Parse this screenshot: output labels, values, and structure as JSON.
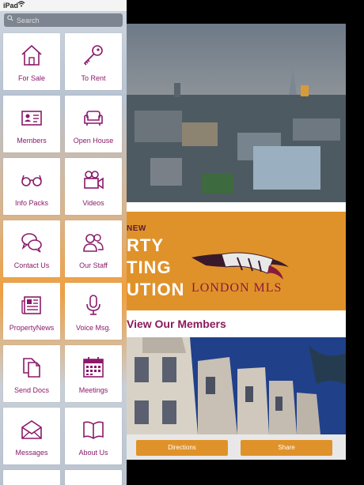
{
  "status": {
    "device": "iPad",
    "wifi_icon": "wifi-icon"
  },
  "search": {
    "placeholder": "Search",
    "icon": "search-icon"
  },
  "menu": [
    {
      "label": "For Sale",
      "icon": "house-icon"
    },
    {
      "label": "To Rent",
      "icon": "key-icon"
    },
    {
      "label": "Members",
      "icon": "id-card-icon"
    },
    {
      "label": "Open House",
      "icon": "sofa-icon"
    },
    {
      "label": "Info Packs",
      "icon": "glasses-icon"
    },
    {
      "label": "Videos",
      "icon": "video-camera-icon"
    },
    {
      "label": "Contact Us",
      "icon": "speech-bubbles-icon"
    },
    {
      "label": "Our Staff",
      "icon": "people-icon"
    },
    {
      "label": "PropertyNews",
      "icon": "newspaper-icon"
    },
    {
      "label": "Voice Msg.",
      "icon": "microphone-icon"
    },
    {
      "label": "Send Docs",
      "icon": "documents-icon"
    },
    {
      "label": "Meetings",
      "icon": "calendar-icon"
    },
    {
      "label": "Messages",
      "icon": "envelope-icon"
    },
    {
      "label": "About Us",
      "icon": "open-book-icon"
    }
  ],
  "banner": {
    "newline": "NEW",
    "line1": "RTY",
    "line2": "TING",
    "line3": "UTION",
    "logo_text": "LONDON MLS"
  },
  "view_members": "View Our Members",
  "actions": {
    "directions": "Directions",
    "share": "Share"
  },
  "colors": {
    "accent": "#8a1a6a",
    "orange": "#e0922a"
  }
}
